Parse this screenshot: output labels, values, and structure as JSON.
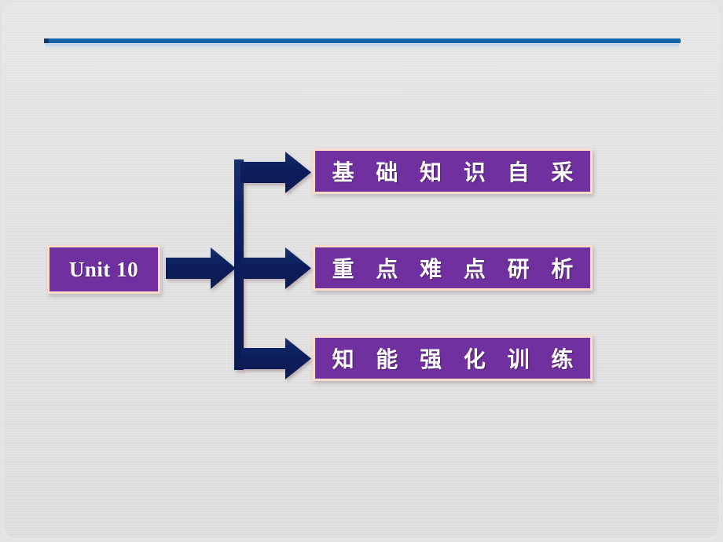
{
  "slide": {
    "background_color": "#e3e3e3",
    "accent_rule_color": "#1563ab",
    "chip_fill_color": "#7030a0",
    "chip_border_color": "#fbdcca",
    "connector_color": "#0e2060"
  },
  "unit": {
    "label": "Unit 10"
  },
  "topics": [
    {
      "label": "基 础 知 识 自 采"
    },
    {
      "label": "重 点 难 点 研 析"
    },
    {
      "label": "知 能 强 化 训 练"
    }
  ],
  "connectors": {
    "stem_arrow_name": "unit-to-trunk-arrow",
    "trunk_name": "vertical-trunk",
    "branch_names": [
      "trunk-to-topic-1-arrow",
      "trunk-to-topic-2-arrow",
      "trunk-to-topic-3-arrow"
    ]
  }
}
